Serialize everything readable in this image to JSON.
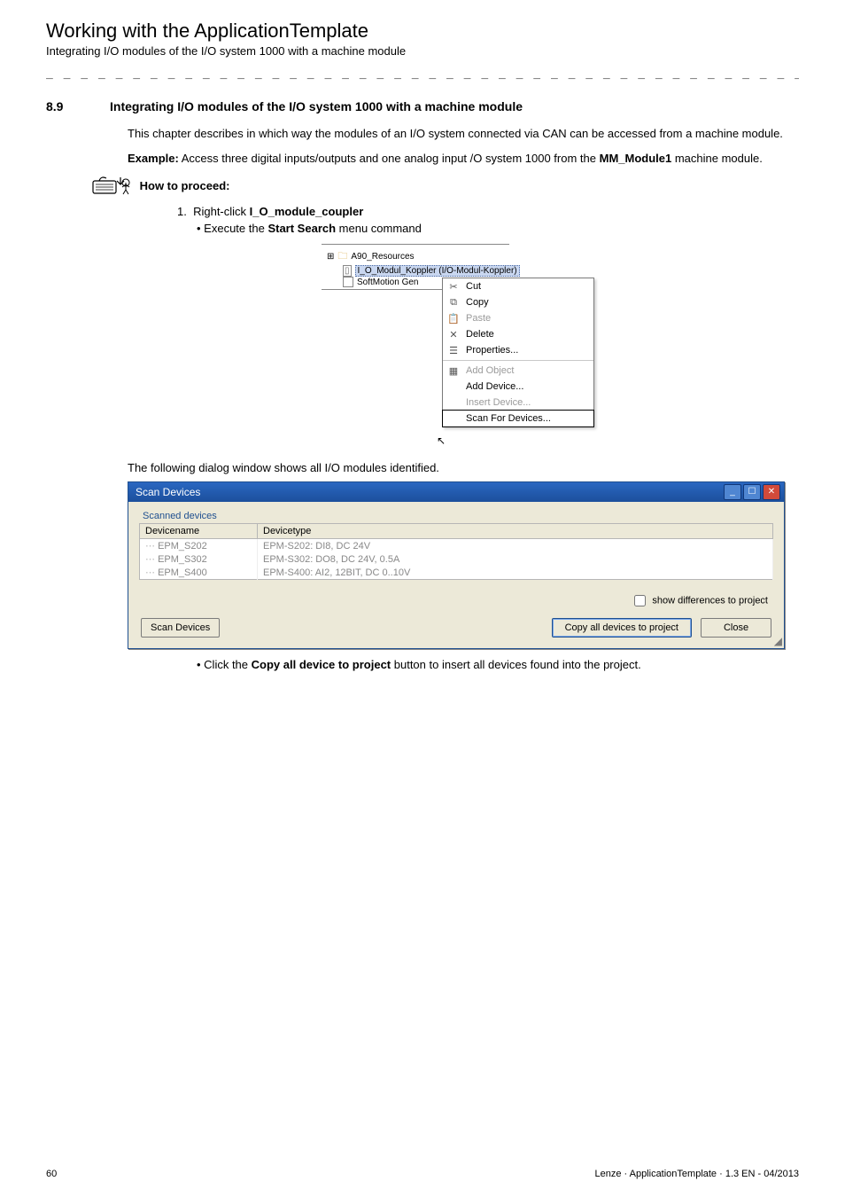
{
  "header": {
    "title": "Working with the ApplicationTemplate",
    "subtitle": "Integrating I/O modules of the I/O system 1000 with a machine module",
    "separator": "_ _ _ _ _ _ _ _ _ _ _ _ _ _ _ _ _ _ _ _ _ _ _ _ _ _ _ _ _ _ _ _ _ _ _ _ _ _ _ _ _ _ _ _ _ _ _ _ _ _ _ _ _ _ _ _ _ _ _ _ _ _ _ _"
  },
  "section": {
    "number": "8.9",
    "title": "Integrating I/O modules of the I/O system 1000 with a machine module"
  },
  "body": {
    "p1": "This chapter describes in which way the modules of an I/O system connected via CAN can be accessed from a machine module.",
    "p2a": "Example:",
    "p2b": " Access three digital inputs/outputs and one analog input /O system 1000 from the ",
    "p2c": "MM_Module1",
    "p2d": " machine module.",
    "howto": "How to proceed:",
    "step1_num": "1.",
    "step1_a": "Right-click ",
    "step1_b": "I_O_module_coupler",
    "step1_sub_a": "Execute the ",
    "step1_sub_b": "Start Search",
    "step1_sub_c": " menu command",
    "caption1": "The following dialog window shows all I/O modules identified.",
    "step2_sub_a": "Click the ",
    "step2_sub_b": "Copy all device to project",
    "step2_sub_c": " button to insert all devices found into the project."
  },
  "ctxmenu": {
    "tree": {
      "folder_prefix": "⊞",
      "folder_label": "A90_Resources",
      "selected": "I_O_Modul_Koppler (I/O-Modul-Koppler)",
      "softmotion": "SoftMotion Gen"
    },
    "items": {
      "cut": "Cut",
      "copy": "Copy",
      "paste": "Paste",
      "delete": "Delete",
      "properties": "Properties...",
      "add_object": "Add Object",
      "add_device": "Add Device...",
      "insert_device": "Insert Device...",
      "scan": "Scan For Devices..."
    }
  },
  "dialog": {
    "title": "Scan Devices",
    "group": "Scanned devices",
    "headers": {
      "name": "Devicename",
      "type": "Devicetype"
    },
    "rows": [
      {
        "name": "EPM_S202",
        "type": "EPM-S202: DI8, DC 24V"
      },
      {
        "name": "EPM_S302",
        "type": "EPM-S302: DO8, DC 24V, 0.5A"
      },
      {
        "name": "EPM_S400",
        "type": "EPM-S400: AI2, 12BIT, DC 0..10V"
      }
    ],
    "show_diff": "show differences to project",
    "scan_btn": "Scan Devices",
    "copy_btn": "Copy all devices to project",
    "close_btn": "Close"
  },
  "footer": {
    "page": "60",
    "meta": "Lenze · ApplicationTemplate · 1.3 EN - 04/2013"
  }
}
